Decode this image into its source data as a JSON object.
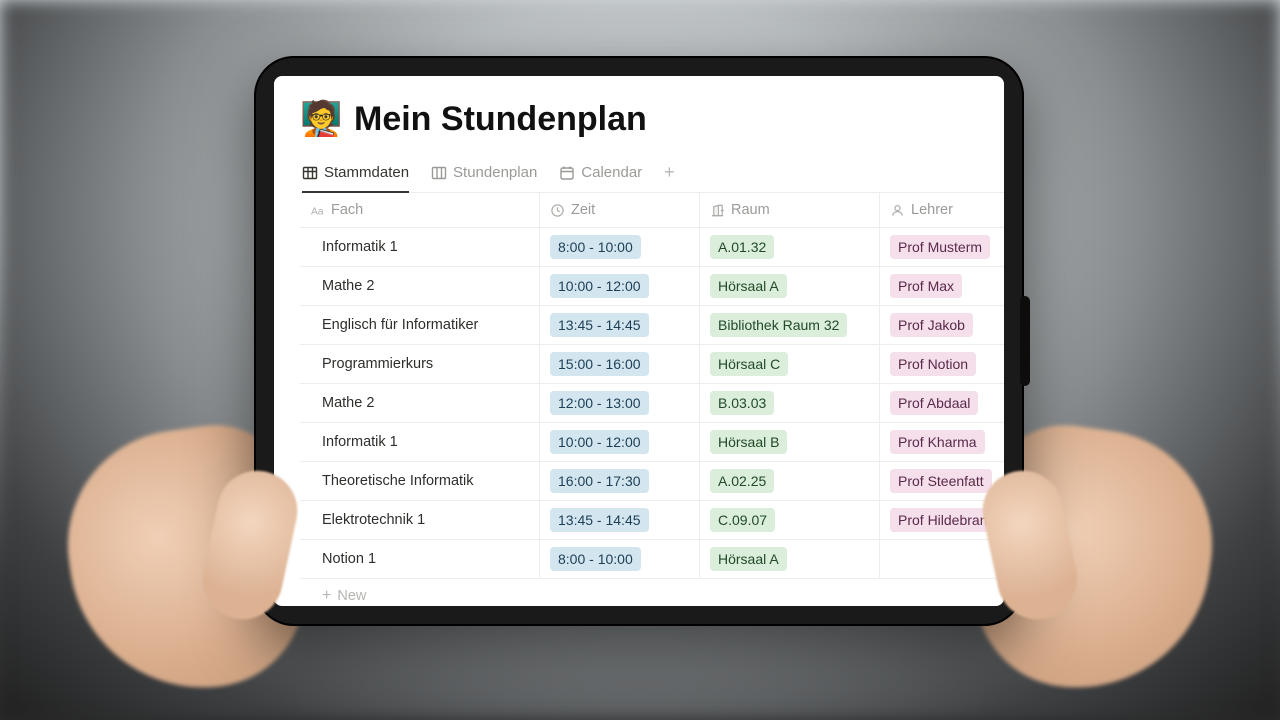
{
  "page": {
    "icon": "🧑‍🏫",
    "title": "Mein Stundenplan"
  },
  "tabs": [
    {
      "label": "Stammdaten",
      "icon": "table",
      "active": true
    },
    {
      "label": "Stundenplan",
      "icon": "board",
      "active": false
    },
    {
      "label": "Calendar",
      "icon": "calendar",
      "active": false
    }
  ],
  "columns": [
    {
      "label": "Fach",
      "icon": "text"
    },
    {
      "label": "Zeit",
      "icon": "clock"
    },
    {
      "label": "Raum",
      "icon": "door"
    },
    {
      "label": "Lehrer",
      "icon": "person"
    }
  ],
  "rows": [
    {
      "fach": "Informatik 1",
      "zeit": "8:00 - 10:00",
      "raum": "A.01.32",
      "lehrer": "Prof Musterm"
    },
    {
      "fach": "Mathe 2",
      "zeit": "10:00 - 12:00",
      "raum": "Hörsaal A",
      "lehrer": "Prof Max"
    },
    {
      "fach": "Englisch für Informatiker",
      "zeit": "13:45 - 14:45",
      "raum": "Bibliothek Raum 32",
      "lehrer": "Prof Jakob"
    },
    {
      "fach": "Programmierkurs",
      "zeit": "15:00 - 16:00",
      "raum": "Hörsaal C",
      "lehrer": "Prof Notion"
    },
    {
      "fach": "Mathe 2",
      "zeit": "12:00 - 13:00",
      "raum": "B.03.03",
      "lehrer": "Prof Abdaal"
    },
    {
      "fach": "Informatik 1",
      "zeit": "10:00 - 12:00",
      "raum": "Hörsaal B",
      "lehrer": "Prof Kharma"
    },
    {
      "fach": "Theoretische Informatik",
      "zeit": "16:00 - 17:30",
      "raum": "A.02.25",
      "lehrer": "Prof Steenfatt"
    },
    {
      "fach": "Elektrotechnik 1",
      "zeit": "13:45 - 14:45",
      "raum": "C.09.07",
      "lehrer": "Prof Hildebran"
    },
    {
      "fach": "Notion 1",
      "zeit": "8:00 - 10:00",
      "raum": "Hörsaal A",
      "lehrer": ""
    }
  ],
  "newRowLabel": "New"
}
